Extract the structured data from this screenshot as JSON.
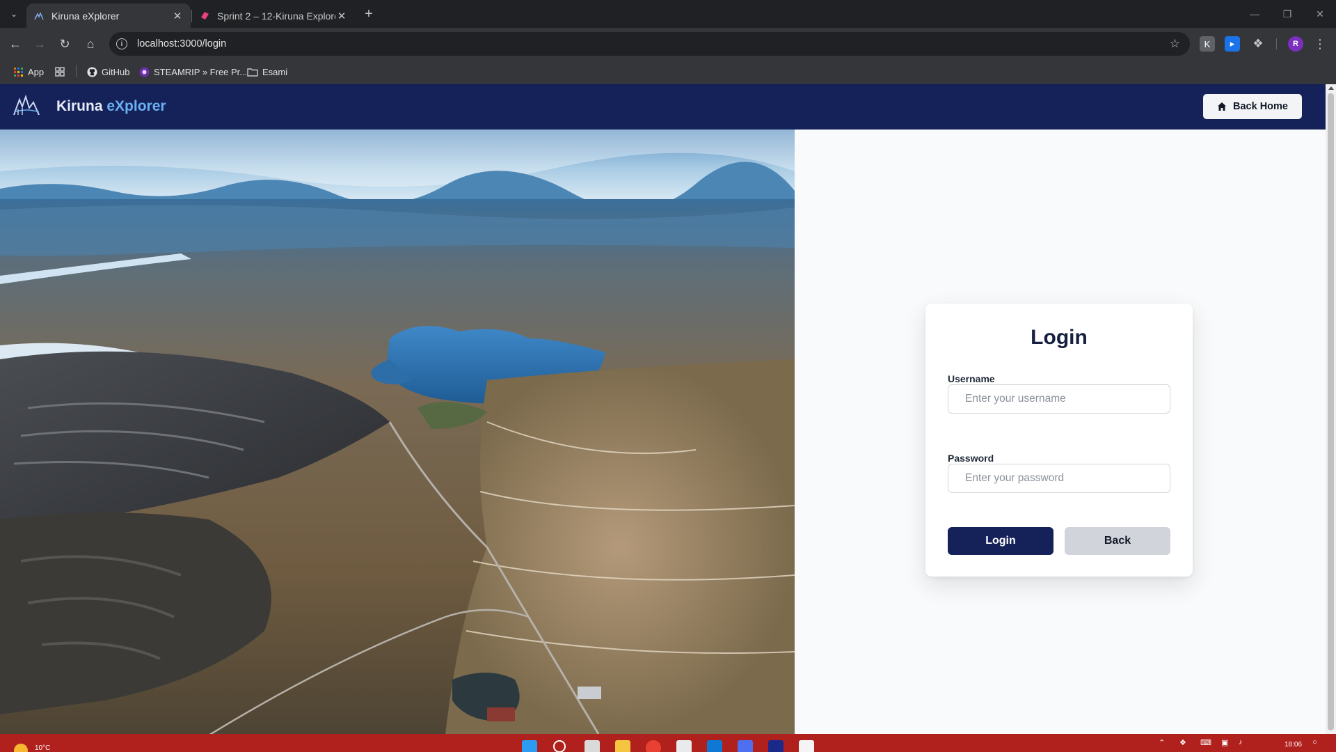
{
  "browser": {
    "tabs": [
      {
        "title": "Kiruna eXplorer",
        "active": true
      },
      {
        "title": "Sprint 2 – 12-Kiruna Explorer Pr",
        "active": false
      }
    ],
    "url": "localhost:3000/login",
    "profile_initial": "R",
    "bookmarks": [
      {
        "label": "App",
        "icon": "apps-grid-icon"
      },
      {
        "label": "",
        "icon": "tab-groups-icon"
      },
      {
        "label": "GitHub",
        "icon": "github-icon"
      },
      {
        "label": "STEAMRIP » Free Pr...",
        "icon": "steamrip-icon"
      },
      {
        "label": "Esami",
        "icon": "folder-icon"
      }
    ]
  },
  "app": {
    "brand_main": "Kiruna",
    "brand_accent": "eXplorer",
    "back_home_label": "Back Home"
  },
  "login": {
    "title": "Login",
    "username_label": "Username",
    "username_placeholder": "Enter your username",
    "password_label": "Password",
    "password_placeholder": "Enter your password",
    "login_button": "Login",
    "back_button": "Back"
  },
  "taskbar": {
    "temperature": "10°C",
    "time": "18:06"
  },
  "colors": {
    "navbar": "#15225a",
    "brand_accent": "#6ab1f0",
    "primary_button": "#15225a",
    "secondary_button": "#d1d5db",
    "taskbar": "#b0201c"
  }
}
